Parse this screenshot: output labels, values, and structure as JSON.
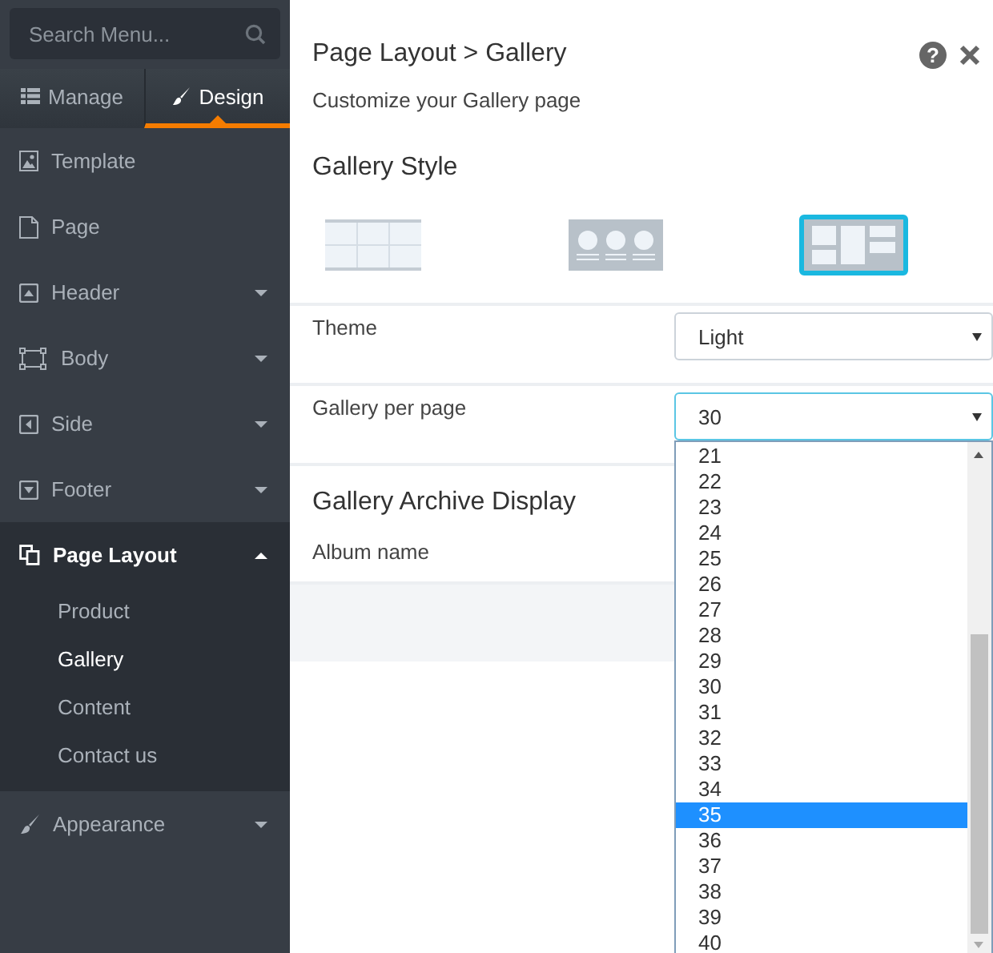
{
  "sidebar": {
    "search": {
      "placeholder": "Search Menu..."
    },
    "tabs": [
      {
        "label": "Manage",
        "selected": false
      },
      {
        "label": "Design",
        "selected": true
      }
    ],
    "items": [
      {
        "label": "Template",
        "kind": "link"
      },
      {
        "label": "Page",
        "kind": "link"
      },
      {
        "label": "Header",
        "kind": "group",
        "expanded": false
      },
      {
        "label": "Body",
        "kind": "group",
        "expanded": false
      },
      {
        "label": "Side",
        "kind": "group",
        "expanded": false
      },
      {
        "label": "Footer",
        "kind": "group",
        "expanded": false
      },
      {
        "label": "Page Layout",
        "kind": "group",
        "expanded": true,
        "children": [
          {
            "label": "Product",
            "selected": false
          },
          {
            "label": "Gallery",
            "selected": true
          },
          {
            "label": "Content",
            "selected": false
          },
          {
            "label": "Contact us",
            "selected": false
          }
        ]
      },
      {
        "label": "Appearance",
        "kind": "group",
        "expanded": false
      }
    ]
  },
  "panel": {
    "title": "Page Layout > Gallery",
    "help": "?",
    "subtitle": "Customize your Gallery page",
    "style_section": {
      "title": "Gallery Style",
      "options": [
        {
          "selected": false
        },
        {
          "selected": false
        },
        {
          "selected": true
        }
      ]
    },
    "fields": [
      {
        "label": "Theme",
        "value": "Light",
        "open": false
      },
      {
        "label": "Gallery per page",
        "value": "30",
        "open": true,
        "options": [
          {
            "label": "21",
            "highlighted": false
          },
          {
            "label": "22",
            "highlighted": false
          },
          {
            "label": "23",
            "highlighted": false
          },
          {
            "label": "24",
            "highlighted": false
          },
          {
            "label": "25",
            "highlighted": false
          },
          {
            "label": "26",
            "highlighted": false
          },
          {
            "label": "27",
            "highlighted": false
          },
          {
            "label": "28",
            "highlighted": false
          },
          {
            "label": "29",
            "highlighted": false
          },
          {
            "label": "30",
            "highlighted": false
          },
          {
            "label": "31",
            "highlighted": false
          },
          {
            "label": "32",
            "highlighted": false
          },
          {
            "label": "33",
            "highlighted": false
          },
          {
            "label": "34",
            "highlighted": false
          },
          {
            "label": "35",
            "highlighted": true
          },
          {
            "label": "36",
            "highlighted": false
          },
          {
            "label": "37",
            "highlighted": false
          },
          {
            "label": "38",
            "highlighted": false
          },
          {
            "label": "39",
            "highlighted": false
          },
          {
            "label": "40",
            "highlighted": false
          }
        ]
      }
    ],
    "archive_section": {
      "title": "Gallery Archive Display",
      "label": "Album name"
    }
  }
}
